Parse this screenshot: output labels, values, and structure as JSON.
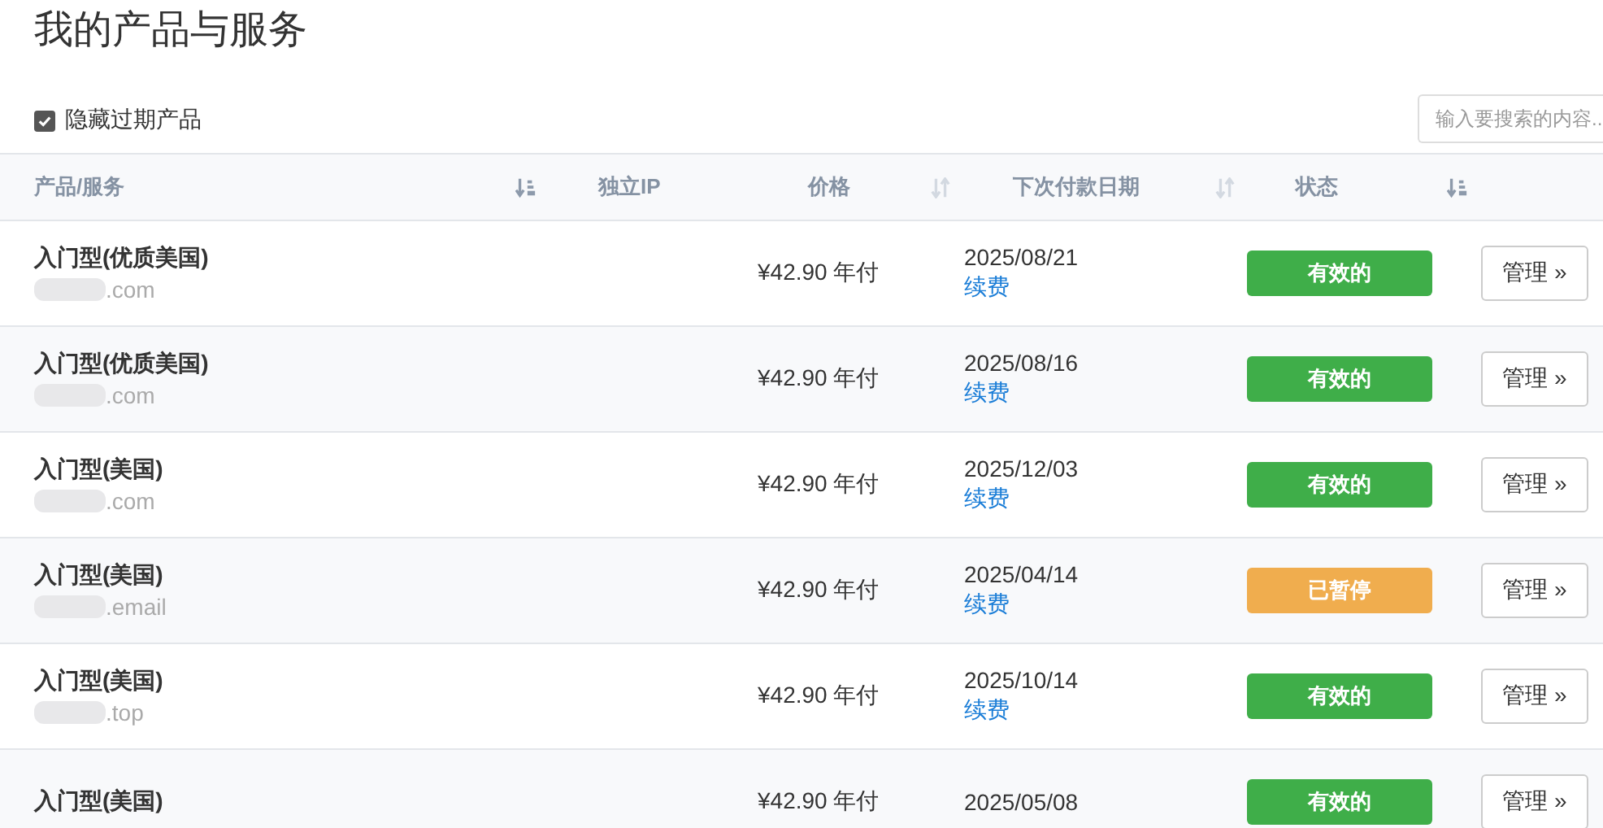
{
  "page_title": "我的产品与服务",
  "filter": {
    "label": "隐藏过期产品",
    "checked": true
  },
  "search": {
    "placeholder": "输入要搜索的内容.."
  },
  "table": {
    "columns": [
      {
        "label": "产品/服务",
        "sorted": true
      },
      {
        "label": "独立IP"
      },
      {
        "label": "价格",
        "sorted": false
      },
      {
        "label": "下次付款日期",
        "sorted": false
      },
      {
        "label": "状态",
        "sorted": true
      }
    ],
    "rows": [
      {
        "product": "入门型(优质美国)",
        "domain": ".com",
        "price": "¥42.90 年付",
        "date": "2025/08/21",
        "renew": "续费",
        "status": "有效的",
        "color": "#3fae49",
        "action": "管理 »"
      },
      {
        "product": "入门型(优质美国)",
        "domain": ".com",
        "price": "¥42.90 年付",
        "date": "2025/08/16",
        "renew": "续费",
        "status": "有效的",
        "color": "#3fae49",
        "action": "管理 »"
      },
      {
        "product": "入门型(美国)",
        "domain": ".com",
        "price": "¥42.90 年付",
        "date": "2025/12/03",
        "renew": "续费",
        "status": "有效的",
        "color": "#3fae49",
        "action": "管理 »"
      },
      {
        "product": "入门型(美国)",
        "domain": ".email",
        "price": "¥42.90 年付",
        "date": "2025/04/14",
        "renew": "续费",
        "status": "已暂停",
        "color": "#f0ad4e",
        "action": "管理 »"
      },
      {
        "product": "入门型(美国)",
        "domain": ".top",
        "price": "¥42.90 年付",
        "date": "2025/10/14",
        "renew": "续费",
        "status": "有效的",
        "color": "#3fae49",
        "action": "管理 »"
      },
      {
        "product": "入门型(美国)",
        "price": "¥42.90 年付",
        "date": "2025/05/08",
        "status": "有效的",
        "color": "#3fae49",
        "action": "管理 »"
      }
    ]
  }
}
